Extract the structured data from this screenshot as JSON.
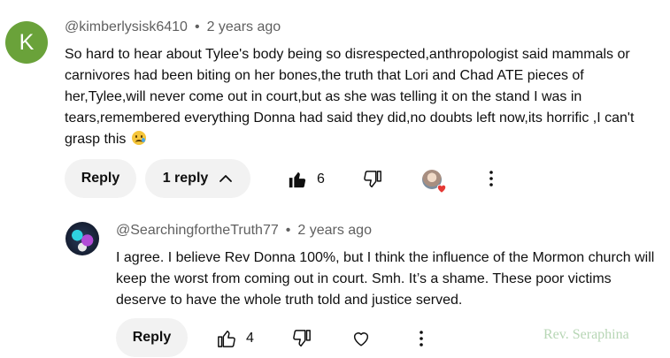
{
  "comment": {
    "avatar_letter": "K",
    "handle": "@kimberlysisk6410",
    "separator": "•",
    "time": "2 years ago",
    "lines": [
      "So hard to hear about Tylee's body being so disrespected,anthropologist said mammals or",
      "carnivores had been biting on her bones,the truth that Lori and Chad ATE pieces of",
      "her,Tylee,will never come out in court,but as she was telling it on the stand I was in",
      "tears,remembered everything Donna had said they did,no doubts left now,its horrific ,I can't",
      "grasp this"
    ],
    "emoji_icon": "crying-face-emoji",
    "reply_label": "Reply",
    "replies_toggle_label": "1 reply",
    "like_count": "6",
    "creator_heart_icon": "creator-heart-badge"
  },
  "reply": {
    "handle": "@SearchingfortheTruth77",
    "separator": "•",
    "time": "2 years ago",
    "lines": [
      "I agree. I believe Rev Donna 100%, but I think the influence of the Mormon church will",
      "keep the worst from coming out in court. Smh. It’s a shame. These poor victims",
      "deserve to have the whole truth told and justice served."
    ],
    "reply_label": "Reply",
    "like_count": "4"
  },
  "watermark": "Rev. Seraphina",
  "colors": {
    "avatar_k": "#6aa23a",
    "pill_bg": "#f2f2f2",
    "meta_text": "#606060",
    "heart": "#e53935",
    "watermark": "#b7d6b5"
  }
}
